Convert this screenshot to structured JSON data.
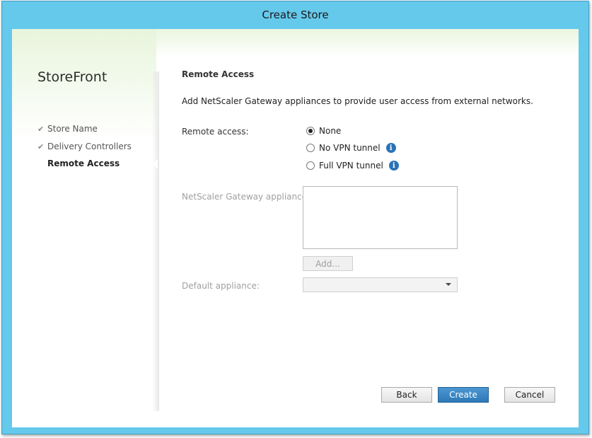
{
  "window": {
    "title": "Create Store"
  },
  "sidebar": {
    "brand": "StoreFront",
    "steps": [
      {
        "label": "Store Name",
        "state": "done"
      },
      {
        "label": "Delivery Controllers",
        "state": "done"
      },
      {
        "label": "Remote Access",
        "state": "current"
      }
    ]
  },
  "main": {
    "heading": "Remote Access",
    "description": "Add NetScaler Gateway appliances to provide user access from external networks.",
    "remote_access": {
      "label": "Remote access:",
      "options": [
        {
          "label": "None",
          "selected": true
        },
        {
          "label": "No VPN tunnel",
          "selected": false,
          "info": "i"
        },
        {
          "label": "Full VPN tunnel",
          "selected": false,
          "info": "i"
        }
      ]
    },
    "gateway": {
      "label": "NetScaler Gateway appliances:",
      "items": []
    },
    "add_button": "Add...",
    "default_appliance": {
      "label": "Default appliance:",
      "value": ""
    }
  },
  "footer": {
    "back": "Back",
    "create": "Create",
    "cancel": "Cancel"
  },
  "colors": {
    "titlebar": "#65c9ec",
    "primary_button": "#2d79b9",
    "info_icon": "#2a73b8"
  }
}
